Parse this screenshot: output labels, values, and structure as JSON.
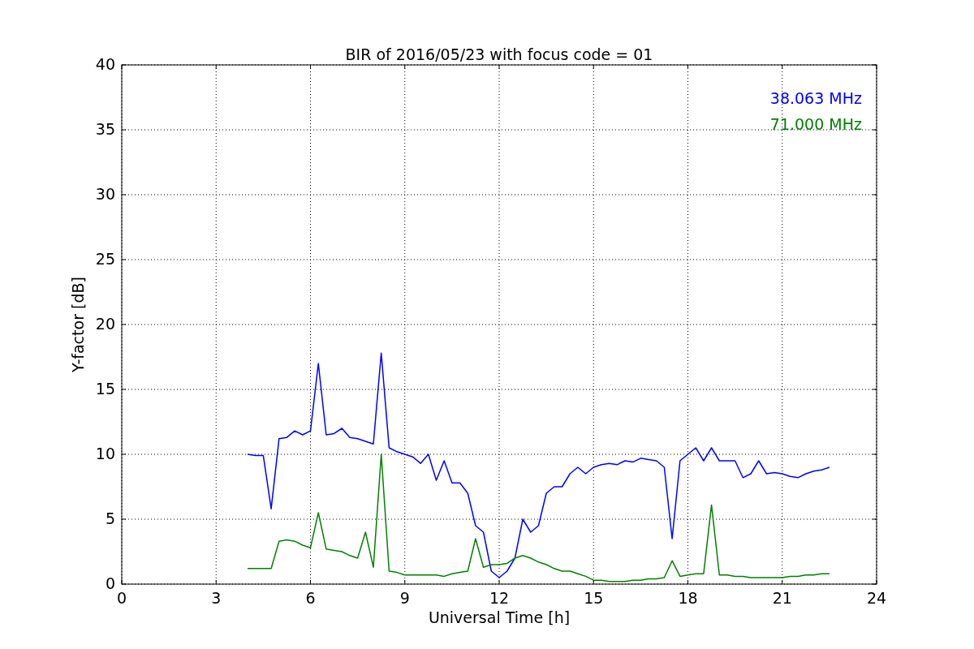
{
  "chart_data": {
    "type": "line",
    "title": "BIR of 2016/05/23 with focus code = 01",
    "xlabel": "Universal Time [h]",
    "ylabel": "Y-factor [dB]",
    "x": [
      4,
      4.25,
      4.5,
      4.75,
      5,
      5.25,
      5.5,
      5.75,
      6,
      6.25,
      6.5,
      6.75,
      7,
      7.25,
      7.5,
      7.75,
      8,
      8.25,
      8.5,
      8.75,
      9,
      9.25,
      9.5,
      9.75,
      10,
      10.25,
      10.5,
      10.75,
      11,
      11.25,
      11.5,
      11.75,
      12,
      12.25,
      12.5,
      12.75,
      13,
      13.25,
      13.5,
      13.75,
      14,
      14.25,
      14.5,
      14.75,
      15,
      15.25,
      15.5,
      15.75,
      16,
      16.25,
      16.5,
      16.75,
      17,
      17.25,
      17.5,
      17.75,
      18,
      18.25,
      18.5,
      18.75,
      19,
      19.25,
      19.5,
      19.75,
      20,
      20.25,
      20.5,
      20.75,
      21,
      21.25,
      21.5,
      21.75,
      22,
      22.25,
      22.5
    ],
    "series": [
      {
        "name": "38.063 MHz",
        "color": "#0000ff",
        "values": [
          10,
          9.9,
          9.9,
          5.8,
          11.2,
          11.3,
          11.8,
          11.5,
          11.8,
          17,
          11.5,
          11.6,
          12,
          11.3,
          11.2,
          11,
          10.8,
          17.8,
          10.5,
          10.2,
          10,
          9.8,
          9.3,
          10,
          8,
          9.5,
          7.8,
          7.8,
          7,
          4.5,
          4,
          1,
          0.5,
          1,
          2,
          5,
          4,
          4.5,
          7,
          7.5,
          7.5,
          8.5,
          9,
          8.5,
          9,
          9.2,
          9.3,
          9.2,
          9.5,
          9.4,
          9.7,
          9.6,
          9.5,
          9,
          3.5,
          9.5,
          10,
          10.5,
          9.5,
          10.5,
          9.5,
          9.5,
          9.5,
          8.2,
          8.5,
          9.5,
          8.5,
          8.6,
          8.5,
          8.3,
          8.2,
          8.5,
          8.7,
          8.8,
          9
        ]
      },
      {
        "name": "71.000 MHz",
        "color": "#008000",
        "values": [
          1.2,
          1.2,
          1.2,
          1.2,
          3.3,
          3.4,
          3.3,
          3,
          2.8,
          5.5,
          2.7,
          2.6,
          2.5,
          2.2,
          2,
          4,
          1.3,
          10,
          1,
          0.9,
          0.7,
          0.7,
          0.7,
          0.7,
          0.7,
          0.6,
          0.8,
          0.9,
          1,
          3.5,
          1.3,
          1.5,
          1.5,
          1.6,
          2,
          2.2,
          2,
          1.7,
          1.5,
          1.2,
          1,
          1,
          0.8,
          0.6,
          0.3,
          0.3,
          0.2,
          0.2,
          0.2,
          0.3,
          0.3,
          0.4,
          0.4,
          0.5,
          1.8,
          0.6,
          0.7,
          0.8,
          0.8,
          6.1,
          0.7,
          0.7,
          0.6,
          0.6,
          0.5,
          0.5,
          0.5,
          0.5,
          0.5,
          0.6,
          0.6,
          0.7,
          0.7,
          0.8,
          0.8
        ]
      }
    ],
    "grid": true,
    "xlim": [
      0,
      24
    ],
    "ylim": [
      0,
      40
    ],
    "xticks": [
      0,
      3,
      6,
      9,
      12,
      15,
      18,
      21,
      24
    ],
    "yticks": [
      0,
      5,
      10,
      15,
      20,
      25,
      30,
      35,
      40
    ]
  }
}
